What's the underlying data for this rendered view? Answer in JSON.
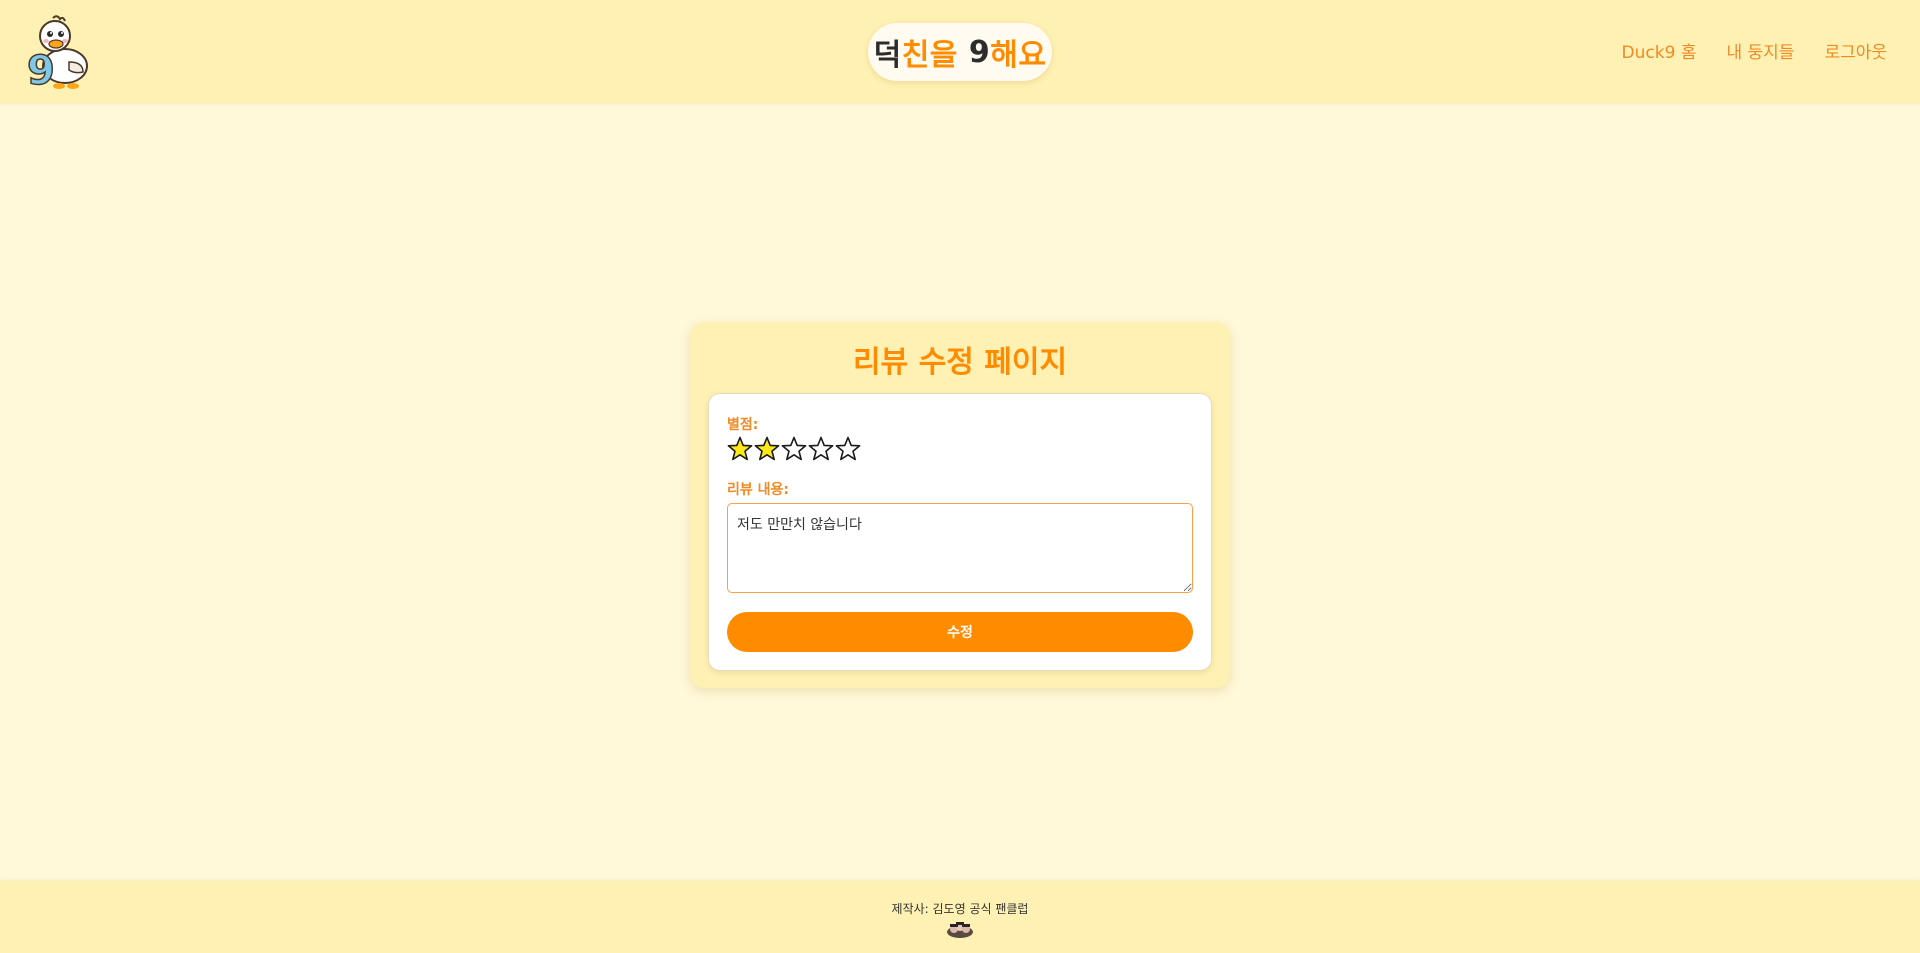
{
  "header": {
    "brand": {
      "part1": "덕",
      "part2": "친을",
      "part3": "9",
      "part4": "해요"
    },
    "nav": [
      {
        "label": "Duck9 홈"
      },
      {
        "label": "내 둥지들"
      },
      {
        "label": "로그아웃"
      }
    ],
    "logo_icon": "duck-9-logo-icon"
  },
  "page": {
    "title": "리뷰 수정 페이지"
  },
  "form": {
    "rating_label": "별점:",
    "rating_value": 2,
    "rating_max": 5,
    "content_label": "리뷰 내용:",
    "content_value": "저도 만만치 않습니다",
    "submit_label": "수정"
  },
  "footer": {
    "text": "제작사: 김도영 공식 팬클럽",
    "icon": "fanclub-icon"
  },
  "colors": {
    "accent": "#FF8C00",
    "header_bg": "#FFF1B3",
    "page_bg": "#FFF8D9",
    "star_filled": "#FFE81A"
  }
}
